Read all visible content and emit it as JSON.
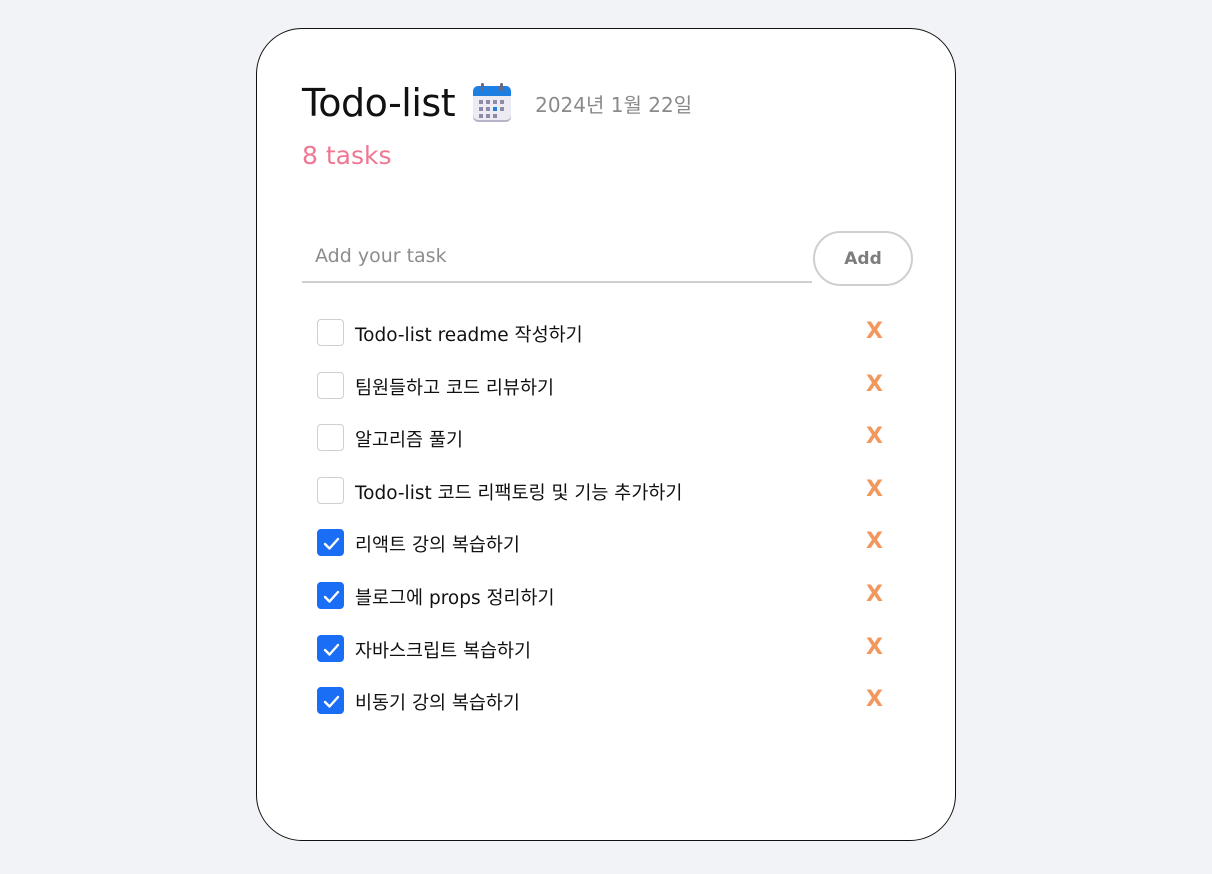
{
  "header": {
    "title": "Todo-list",
    "date": "2024년 1월 22일",
    "calendar_icon": "calendar-icon"
  },
  "count": "8 tasks",
  "input": {
    "placeholder": "Add your task",
    "value": ""
  },
  "add_button": {
    "label": "Add"
  },
  "delete_label": "X",
  "colors": {
    "background": "#f2f3f7",
    "count": "#f07791",
    "checkbox_checked": "#1a6ef5",
    "delete": "#f2975d"
  },
  "tasks": [
    {
      "text": "Todo-list readme 작성하기",
      "done": false
    },
    {
      "text": "팀원들하고 코드 리뷰하기",
      "done": false
    },
    {
      "text": "알고리즘 풀기",
      "done": false
    },
    {
      "text": "Todo-list 코드 리팩토링 및 기능 추가하기",
      "done": false
    },
    {
      "text": "리액트 강의 복습하기",
      "done": true
    },
    {
      "text": "블로그에 props 정리하기",
      "done": true
    },
    {
      "text": "자바스크립트 복습하기",
      "done": true
    },
    {
      "text": "비동기 강의 복습하기",
      "done": true
    }
  ]
}
